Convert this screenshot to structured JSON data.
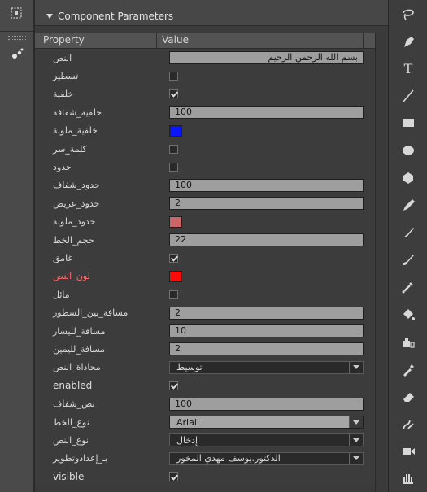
{
  "panel": {
    "title": "Component Parameters"
  },
  "table": {
    "header_property": "Property",
    "header_value": "Value"
  },
  "rows": [
    {
      "label": "النص",
      "kind": "text",
      "value": "بسم الله الرحمن الرحيم",
      "rtl": true
    },
    {
      "label": "تسطير",
      "kind": "checkbox",
      "checked": false
    },
    {
      "label": "خلفية",
      "kind": "checkbox",
      "checked": true
    },
    {
      "label": "خلفية_شفافة",
      "kind": "text",
      "value": "100"
    },
    {
      "label": "خلفية_ملونة",
      "kind": "color",
      "color": "#0a14ff"
    },
    {
      "label": "كلمة_سر",
      "kind": "checkbox",
      "checked": false
    },
    {
      "label": "حدود",
      "kind": "checkbox",
      "checked": false
    },
    {
      "label": "حدود_شفاف",
      "kind": "text",
      "value": "100"
    },
    {
      "label": "حدود_عريض",
      "kind": "text",
      "value": "2"
    },
    {
      "label": "حدود_ملونة",
      "kind": "color",
      "color": "#cc6666"
    },
    {
      "label": "حجم_الخط",
      "kind": "text",
      "value": "22"
    },
    {
      "label": "غامق",
      "kind": "checkbox",
      "checked": true
    },
    {
      "label": "لون_النص",
      "kind": "color",
      "color": "#ff0a0a",
      "red": true
    },
    {
      "label": "مائل",
      "kind": "checkbox",
      "checked": false
    },
    {
      "label": "مسافة_بين_السطور",
      "kind": "text",
      "value": "2"
    },
    {
      "label": "مسافة_لليسار",
      "kind": "text",
      "value": "10"
    },
    {
      "label": "مسافة_لليمين",
      "kind": "text",
      "value": "2"
    },
    {
      "label": "محاذاة_النص",
      "kind": "select",
      "value": "توسيط"
    },
    {
      "label": "enabled",
      "kind": "checkbox",
      "checked": true,
      "en": true
    },
    {
      "label": "نص_شفاف",
      "kind": "text",
      "value": "100"
    },
    {
      "label": "نوع_الخط",
      "kind": "select",
      "value": "Arial",
      "light": true
    },
    {
      "label": "نوع_النص",
      "kind": "select",
      "value": "إدخال"
    },
    {
      "label": "بـ_إعدادوتطوير",
      "kind": "select",
      "value": "الدكتور.يوسف مهدي المخور"
    },
    {
      "label": "visible",
      "kind": "checkbox",
      "checked": true,
      "en": true
    }
  ],
  "colors": {
    "panel_bg": "#3b3b3b",
    "input_bg": "#9e9e9e",
    "label_text": "#d8d8d8",
    "red_label": "#ff6a6a"
  },
  "left_icons": [
    "grid-box-icon",
    "grip-handle-icon",
    "drops-icon"
  ],
  "tools": [
    "lasso-icon",
    "pen-icon",
    "text-icon",
    "line-icon",
    "rectangle-icon",
    "oval-icon",
    "polystar-icon",
    "pencil-icon",
    "brush-icon",
    "paint-brush-icon",
    "bone-icon",
    "paint-bucket-icon",
    "ink-bottle-icon",
    "eyedropper-icon",
    "eraser-icon",
    "deco-icon",
    "camera-icon",
    "hand-icon"
  ]
}
